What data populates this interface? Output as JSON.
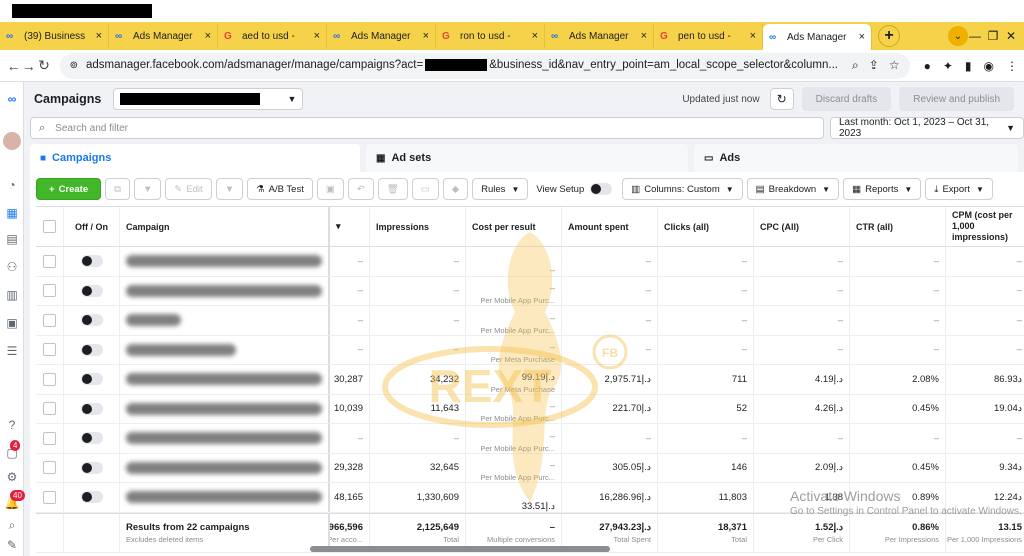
{
  "browser": {
    "tabs": [
      {
        "icon": "meta",
        "label": "(39) Business"
      },
      {
        "icon": "meta",
        "label": "Ads Manager"
      },
      {
        "icon": "google",
        "label": "aed to usd -"
      },
      {
        "icon": "meta",
        "label": "Ads Manager"
      },
      {
        "icon": "google",
        "label": "ron to usd -"
      },
      {
        "icon": "meta",
        "label": "Ads Manager"
      },
      {
        "icon": "google",
        "label": "pen to usd -"
      },
      {
        "icon": "meta",
        "label": "Ads Manager"
      }
    ],
    "url_start": "adsmanager.facebook.com/adsmanager/manage/campaigns?act=",
    "url_end": "&business_id&nav_entry_point=am_local_scope_selector&column..."
  },
  "header": {
    "title": "Campaigns",
    "updated": "Updated just now",
    "discard": "Discard drafts",
    "publish": "Review and publish"
  },
  "search": {
    "placeholder": "Search and filter",
    "date_range": "Last month: Oct 1, 2023 – Oct 31, 2023"
  },
  "levels": {
    "campaigns": "Campaigns",
    "adsets": "Ad sets",
    "ads": "Ads"
  },
  "toolbar": {
    "create": "Create",
    "edit": "Edit",
    "ab_test": "A/B Test",
    "rules": "Rules",
    "view_setup": "View Setup",
    "columns": "Columns: Custom",
    "breakdown": "Breakdown",
    "reports": "Reports",
    "export": "Export"
  },
  "columns": {
    "off_on": "Off / On",
    "campaign": "Campaign",
    "impressions": "Impressions",
    "cost_per_result": "Cost per result",
    "amount_spent": "Amount spent",
    "clicks": "Clicks (all)",
    "cpc": "CPC (All)",
    "ctr": "CTR (all)",
    "cpm": "CPM (cost per 1,000 impressions)"
  },
  "rows": [
    {
      "res": "–",
      "imp": "–",
      "cpr": "–",
      "cpr_sub": "",
      "amt": "–",
      "clk": "–",
      "cpc": "–",
      "ctr": "–",
      "cpm": "–"
    },
    {
      "res": "–",
      "imp": "–",
      "cpr": "–",
      "cpr_sub": "Per Mobile App Purc...",
      "amt": "–",
      "clk": "–",
      "cpc": "–",
      "ctr": "–",
      "cpm": "–"
    },
    {
      "res": "–",
      "imp": "–",
      "cpr": "–",
      "cpr_sub": "Per Mobile App Purc...",
      "amt": "–",
      "clk": "–",
      "cpc": "–",
      "ctr": "–",
      "cpm": "–"
    },
    {
      "res": "–",
      "imp": "–",
      "cpr": "–",
      "cpr_sub": "Per Meta Purchase",
      "amt": "–",
      "clk": "–",
      "cpc": "–",
      "ctr": "–",
      "cpm": "–"
    },
    {
      "res": "30,287",
      "imp": "34,232",
      "cpr": "99.19د.إ",
      "cpr_sub": "Per Meta Purchase",
      "amt": "2,975.71د.إ",
      "clk": "711",
      "cpc": "4.19د.إ",
      "ctr": "2.08%",
      "cpm": "86.93د"
    },
    {
      "res": "10,039",
      "imp": "11,643",
      "cpr": "–",
      "cpr_sub": "Per Mobile App Purc...",
      "amt": "221.70د.إ",
      "clk": "52",
      "cpc": "4.26د.إ",
      "ctr": "0.45%",
      "cpm": "19.04د"
    },
    {
      "res": "–",
      "imp": "–",
      "cpr": "–",
      "cpr_sub": "Per Mobile App Purc...",
      "amt": "–",
      "clk": "–",
      "cpc": "–",
      "ctr": "–",
      "cpm": "–"
    },
    {
      "res": "29,328",
      "imp": "32,645",
      "cpr": "–",
      "cpr_sub": "Per Mobile App Purc...",
      "amt": "305.05د.إ",
      "clk": "146",
      "cpc": "2.09د.إ",
      "ctr": "0.45%",
      "cpm": "9.34د"
    },
    {
      "res": "48,165",
      "imp": "1,330,609",
      "cpr": "33.51د.إ",
      "cpr_sub": "",
      "amt": "16,286.96د.إ",
      "clk": "11,803",
      "cpc": "1.38",
      "ctr": "0.89%",
      "cpm": "12.24د"
    }
  ],
  "totals": {
    "label": "Results from 22 campaigns",
    "sub": "Excludes deleted items",
    "res": "966,596",
    "res_sub": "Per acco...",
    "imp": "2,125,649",
    "imp_sub": "Total",
    "cpr": "–",
    "cpr_sub": "Multiple conversions",
    "amt": "27,943.23د.إ",
    "amt_sub": "Total Spent",
    "clk": "18,371",
    "clk_sub": "Total",
    "cpc": "1.52د.إ",
    "cpc_sub": "Per Click",
    "ctr": "0.86%",
    "ctr_sub": "Per Impressions",
    "cpm": "13.15",
    "cpm_sub": "Per 1,000 Impressions"
  },
  "rail_badges": {
    "notif1": "4",
    "notif2": "40"
  },
  "activation": {
    "title": "Activate Windows",
    "sub": "Go to Settings in Control Panel to activate Windows."
  },
  "watermark": {
    "text": "REXT",
    "sub": "FB"
  }
}
